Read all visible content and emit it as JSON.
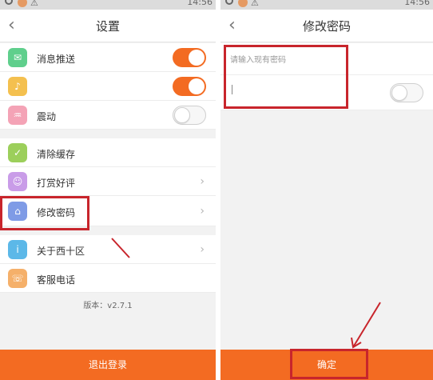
{
  "left_screen": {
    "title": "设置",
    "items": [
      {
        "label": "消息推送",
        "icon": "message-icon",
        "control": "toggle",
        "state": "on"
      },
      {
        "label": "",
        "icon": "sound-icon",
        "control": "toggle",
        "state": "on"
      },
      {
        "label": "震动",
        "icon": "vibrate-icon",
        "control": "toggle",
        "state": "off"
      },
      {
        "label": "清除缓存",
        "icon": "broom-icon",
        "control": "none"
      },
      {
        "label": "打赏好评",
        "icon": "smile-icon",
        "control": "chevron"
      },
      {
        "label": "修改密码",
        "icon": "lock-icon",
        "control": "chevron"
      },
      {
        "label": "关于西十区",
        "icon": "info-icon",
        "control": "chevron"
      },
      {
        "label": "客服电话",
        "icon": "phone-icon",
        "control": "none"
      }
    ],
    "version": "版本：v2.7.1",
    "logout_label": "退出登录"
  },
  "right_screen": {
    "title": "修改密码",
    "placeholder": "请输入现有密码",
    "toggle_state": "off",
    "confirm_label": "确定"
  },
  "status_bar": {
    "left_time": "14:56",
    "right_time": "14:56"
  },
  "colors": {
    "accent": "#f36b22",
    "highlight_box": "#c8252c",
    "background": "#f2f2f2"
  }
}
